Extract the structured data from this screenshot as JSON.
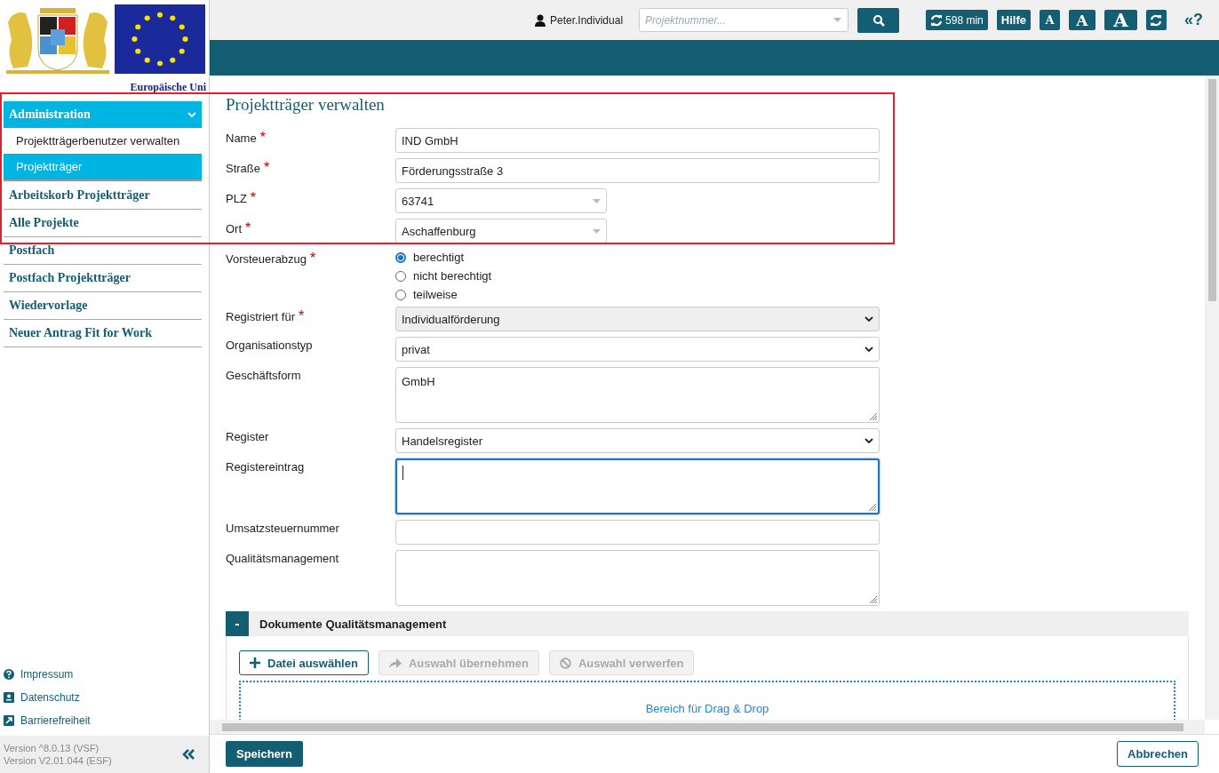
{
  "header": {
    "user": "Peter.Individual",
    "search": {
      "placeholder": "Projektnummer..."
    },
    "session": "598 min",
    "help": "Hilfe",
    "font_sizes": [
      "A",
      "A",
      "A"
    ],
    "help_toggle": "«?"
  },
  "sidebar": {
    "logo_caption": "Europäische Uni",
    "items": [
      {
        "label": "Administration",
        "expanded": true,
        "selected": true,
        "children": [
          {
            "label": "Projektträgerbenutzer verwalten",
            "selected": false
          },
          {
            "label": "Projektträger",
            "selected": true
          }
        ]
      },
      {
        "label": "Arbeitskorb Projektträger",
        "selected": false
      },
      {
        "label": "Alle Projekte",
        "selected": false
      },
      {
        "label": "Postfach",
        "selected": false
      },
      {
        "label": "Postfach Projektträger",
        "selected": false
      },
      {
        "label": "Wiedervorlage",
        "selected": false
      },
      {
        "label": "Neuer Antrag Fit for Work",
        "selected": false
      }
    ],
    "links": [
      {
        "label": "Impressum",
        "kind": "help"
      },
      {
        "label": "Datenschutz",
        "kind": "privacy"
      },
      {
        "label": "Barrierefreiheit",
        "kind": "access"
      }
    ],
    "versions": [
      "Version ^8.0.13 (VSF)",
      "Version V2.01.044 (ESF)"
    ]
  },
  "form": {
    "title": "Projektträger verwalten",
    "fields": [
      {
        "label": "Name",
        "required_mark": "*",
        "kind": "text",
        "value": "IND GmbH"
      },
      {
        "label": "Straße",
        "required_mark": "*",
        "kind": "text",
        "value": "Förderungsstraße 3"
      },
      {
        "label": "PLZ",
        "required_mark": "*",
        "kind": "combo",
        "value": "63741"
      },
      {
        "label": "Ort",
        "required_mark": "*",
        "kind": "combo",
        "value": "Aschaffenburg"
      },
      {
        "label": "Vorsteuerabzug",
        "required_mark": "*",
        "kind": "radio",
        "options": [
          {
            "label": "berechtigt",
            "selected": true
          },
          {
            "label": "nicht berechtigt",
            "selected": false
          },
          {
            "label": "teilweise",
            "selected": false
          }
        ]
      },
      {
        "label": "Registriert für",
        "required_mark": "*",
        "kind": "select",
        "value": "Individualförderung",
        "disabled": true
      },
      {
        "label": "Organisationstyp",
        "kind": "select",
        "value": "privat",
        "disabled": false
      },
      {
        "label": "Geschäftsform",
        "kind": "textarea",
        "value": "GmbH",
        "focused": false
      },
      {
        "label": "Register",
        "kind": "select",
        "value": "Handelsregister",
        "disabled": false
      },
      {
        "label": "Registereintrag",
        "kind": "textarea",
        "focused": true
      },
      {
        "label": "Umsatzsteuernummer",
        "kind": "text"
      },
      {
        "label": "Qualitätsmanagement",
        "kind": "textarea",
        "focused": false
      }
    ]
  },
  "section": {
    "toggle": "-",
    "title": "Dokumente Qualitätsmanagement",
    "expanded": true,
    "buttons": [
      {
        "label": "Datei auswählen",
        "kind": "add",
        "disabled": false
      },
      {
        "label": "Auswahl übernehmen",
        "kind": "share",
        "disabled": true
      },
      {
        "label": "Auswahl verwerfen",
        "kind": "discard",
        "disabled": true
      }
    ],
    "dropzone": "Bereich für Drag & Drop"
  },
  "actions": [
    {
      "label": "Speichern",
      "kind": "primary"
    },
    {
      "label": "Abbrechen",
      "kind": "secondary"
    }
  ]
}
